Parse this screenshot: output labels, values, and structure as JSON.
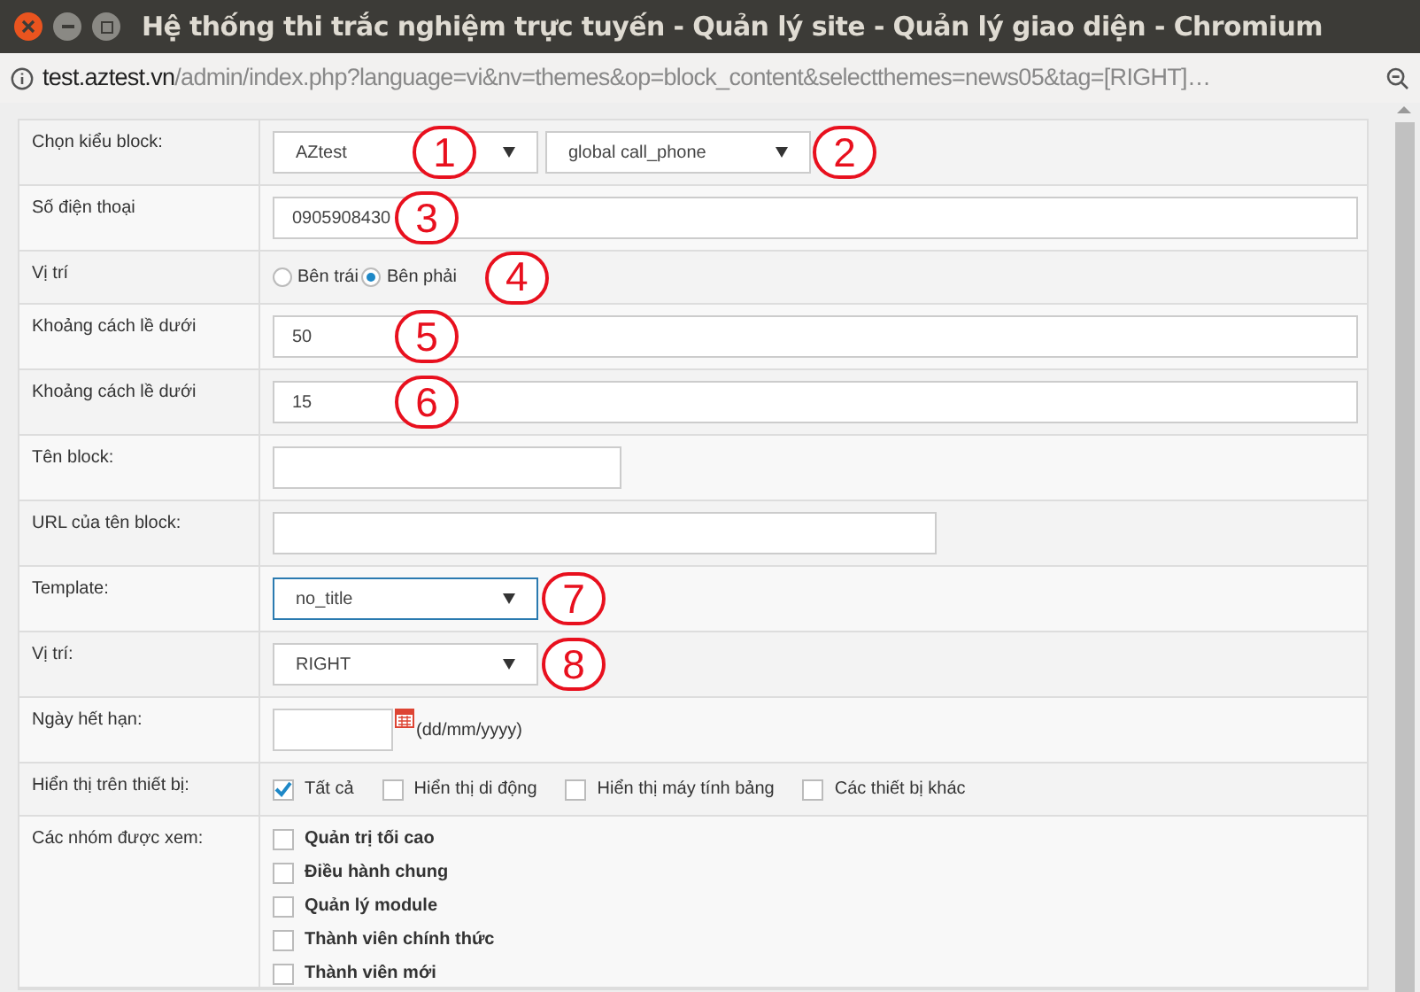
{
  "window": {
    "title": "Hệ thống thi trắc nghiệm trực tuyến - Quản lý site - Quản lý giao diện - Chromium"
  },
  "address_bar": {
    "domain": "test.aztest.vn",
    "path": "/admin/index.php?language=vi&nv=themes&op=block_content&selectthemes=news05&tag=[RIGHT]…"
  },
  "form": [
    {
      "kind": "select_pair",
      "label": "Chọn kiểu block:",
      "selects": [
        {
          "value": "AZtest",
          "annotation": "1"
        },
        {
          "value": "global call_phone",
          "annotation": "2"
        }
      ]
    },
    {
      "kind": "text_wide",
      "label": "Số điện thoại",
      "value": "0905908430",
      "annotation": "3"
    },
    {
      "kind": "radio",
      "label": "Vị trí",
      "options": [
        {
          "label": "Bên trái",
          "selected": false
        },
        {
          "label": "Bên phải",
          "selected": true
        }
      ],
      "annotation": "4"
    },
    {
      "kind": "text_wide",
      "label": "Khoảng cách lề dưới",
      "value": "50",
      "annotation": "5"
    },
    {
      "kind": "text_wide",
      "label": "Khoảng cách lề dưới",
      "value": "15",
      "annotation": "6"
    },
    {
      "kind": "text_short",
      "label": "Tên block:"
    },
    {
      "kind": "text_medium",
      "label": "URL của tên block:"
    },
    {
      "kind": "select",
      "label": "Template:",
      "value": "no_title",
      "focused": true,
      "annotation": "7"
    },
    {
      "kind": "select",
      "label": "Vị trí:",
      "value": "RIGHT",
      "focused": false,
      "annotation": "8"
    },
    {
      "kind": "date",
      "label": "Ngày hết hạn:",
      "hint": "(dd/mm/yyyy)"
    },
    {
      "kind": "checkbox_inline",
      "label": "Hiển thị trên thiết bị:",
      "options": [
        {
          "label": "Tất cả",
          "checked": true
        },
        {
          "label": "Hiển thị di động",
          "checked": false
        },
        {
          "label": "Hiển thị máy tính bảng",
          "checked": false
        },
        {
          "label": "Các thiết bị khác",
          "checked": false
        }
      ]
    },
    {
      "kind": "checkbox_list",
      "label": "Các nhóm được xem:",
      "options": [
        {
          "label": "Quản trị tối cao",
          "checked": false
        },
        {
          "label": "Điều hành chung",
          "checked": false
        },
        {
          "label": "Quản lý module",
          "checked": false
        },
        {
          "label": "Thành viên chính thức",
          "checked": false
        },
        {
          "label": "Thành viên mới",
          "checked": false
        }
      ]
    }
  ]
}
